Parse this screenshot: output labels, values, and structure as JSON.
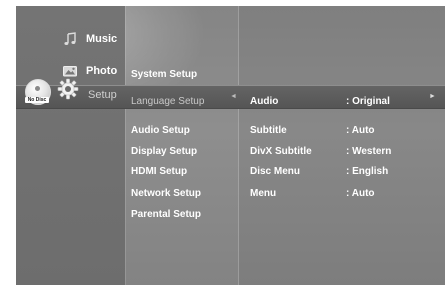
{
  "main_menu": [
    {
      "label": "Music",
      "icon": "music-icon"
    },
    {
      "label": "Photo",
      "icon": "photo-icon"
    },
    {
      "label": "Setup",
      "icon": "gear-icon",
      "selected": true
    }
  ],
  "disc_status": "No Disc",
  "setup_menu": [
    "System Setup",
    "Language Setup",
    "Audio Setup",
    "Display Setup",
    "HDMI Setup",
    "Network Setup",
    "Parental Setup"
  ],
  "selected_setup": "Language Setup",
  "language_options": [
    {
      "name": "Audio",
      "value": ": Original",
      "selected": true
    },
    {
      "name": "Subtitle",
      "value": ": Auto"
    },
    {
      "name": "DivX Subtitle",
      "value": ": Western"
    },
    {
      "name": "Disc Menu",
      "value": ": English"
    },
    {
      "name": "Menu",
      "value": ": Auto"
    }
  ],
  "colors": {
    "background": "#7f7f7f",
    "selection_band": "#5a5a5a",
    "text": "#ffffff"
  }
}
